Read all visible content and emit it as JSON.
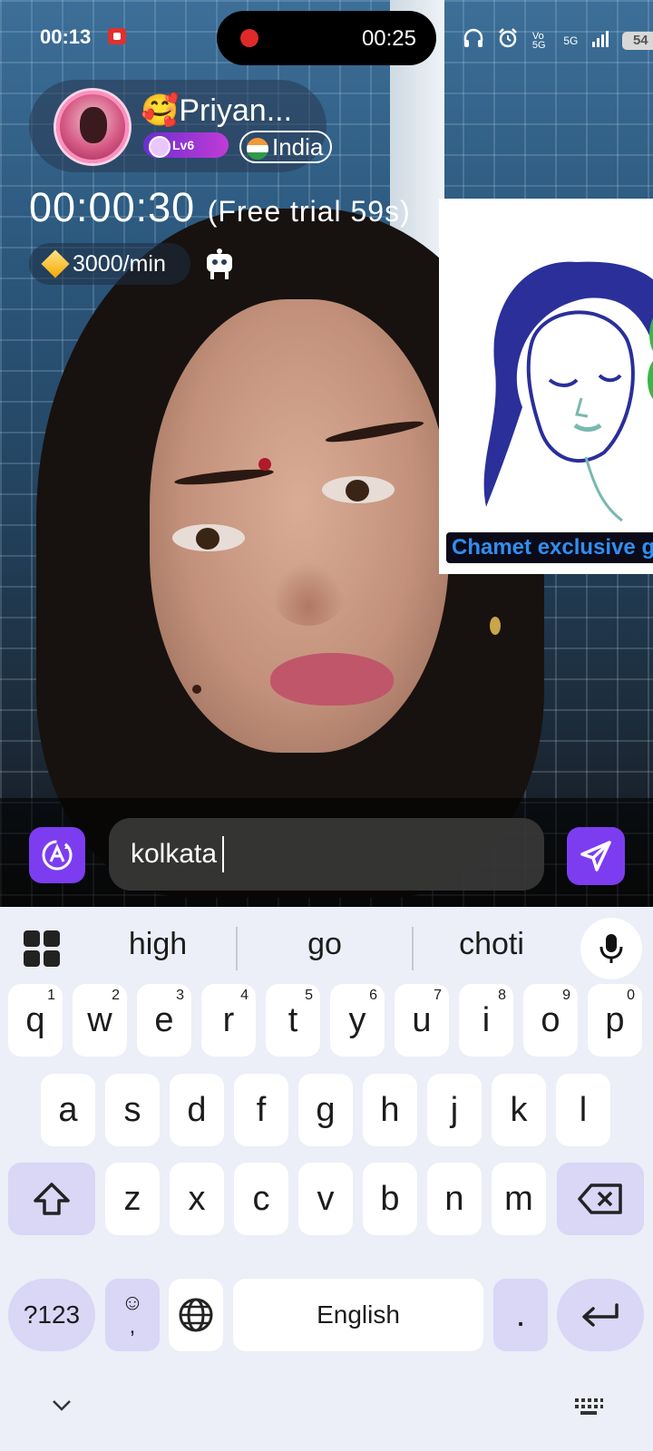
{
  "status_bar": {
    "time": "00:13",
    "call_timer": "00:25",
    "network": "5G",
    "volte": "Vo 5G",
    "battery": "54"
  },
  "profile": {
    "name": "🥰Priyan...",
    "level": "Lv6",
    "country": "India"
  },
  "call": {
    "elapsed": "00:00:30",
    "trial": "(Free trial 59s)",
    "rate": "3000/min"
  },
  "ad": {
    "label": "Chamet exclusive g"
  },
  "chat": {
    "input_value": "kolkata"
  },
  "keyboard": {
    "suggestions": [
      "high",
      "go",
      "choti"
    ],
    "row1": [
      {
        "k": "q",
        "n": "1"
      },
      {
        "k": "w",
        "n": "2"
      },
      {
        "k": "e",
        "n": "3"
      },
      {
        "k": "r",
        "n": "4"
      },
      {
        "k": "t",
        "n": "5"
      },
      {
        "k": "y",
        "n": "6"
      },
      {
        "k": "u",
        "n": "7"
      },
      {
        "k": "i",
        "n": "8"
      },
      {
        "k": "o",
        "n": "9"
      },
      {
        "k": "p",
        "n": "0"
      }
    ],
    "row2": [
      "a",
      "s",
      "d",
      "f",
      "g",
      "h",
      "j",
      "k",
      "l"
    ],
    "row3": [
      "z",
      "x",
      "c",
      "v",
      "b",
      "n",
      "m"
    ],
    "symbols_label": "?123",
    "emoji_label": "☺",
    "comma_label": ",",
    "space_label": "English",
    "period_label": "."
  },
  "colors": {
    "accent": "#7c3df0",
    "key_dark": "#d9d6f6",
    "keyboard_bg": "#eceef8"
  }
}
